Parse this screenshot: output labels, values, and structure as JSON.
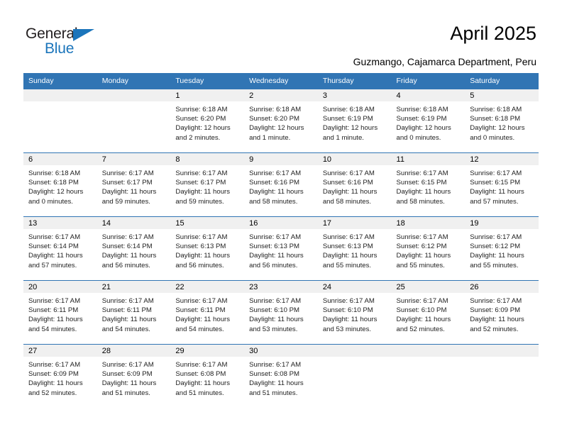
{
  "brand": {
    "name_part1": "General",
    "name_part2": "Blue",
    "triangle_icon": "triangle-icon",
    "color_dark": "#231f20",
    "color_blue": "#1b75bb"
  },
  "header": {
    "title": "April 2025",
    "subtitle": "Guzmango, Cajamarca Department, Peru"
  },
  "calendar": {
    "accent_color": "#3175b4",
    "daynum_band_color": "#f0f0f0",
    "weekday_headers": [
      "Sunday",
      "Monday",
      "Tuesday",
      "Wednesday",
      "Thursday",
      "Friday",
      "Saturday"
    ],
    "weeks": [
      [
        {
          "day": "",
          "empty": true
        },
        {
          "day": "",
          "empty": true
        },
        {
          "day": "1",
          "sunrise": "Sunrise: 6:18 AM",
          "sunset": "Sunset: 6:20 PM",
          "daylight": "Daylight: 12 hours and 2 minutes."
        },
        {
          "day": "2",
          "sunrise": "Sunrise: 6:18 AM",
          "sunset": "Sunset: 6:20 PM",
          "daylight": "Daylight: 12 hours and 1 minute."
        },
        {
          "day": "3",
          "sunrise": "Sunrise: 6:18 AM",
          "sunset": "Sunset: 6:19 PM",
          "daylight": "Daylight: 12 hours and 1 minute."
        },
        {
          "day": "4",
          "sunrise": "Sunrise: 6:18 AM",
          "sunset": "Sunset: 6:19 PM",
          "daylight": "Daylight: 12 hours and 0 minutes."
        },
        {
          "day": "5",
          "sunrise": "Sunrise: 6:18 AM",
          "sunset": "Sunset: 6:18 PM",
          "daylight": "Daylight: 12 hours and 0 minutes."
        }
      ],
      [
        {
          "day": "6",
          "sunrise": "Sunrise: 6:18 AM",
          "sunset": "Sunset: 6:18 PM",
          "daylight": "Daylight: 12 hours and 0 minutes."
        },
        {
          "day": "7",
          "sunrise": "Sunrise: 6:17 AM",
          "sunset": "Sunset: 6:17 PM",
          "daylight": "Daylight: 11 hours and 59 minutes."
        },
        {
          "day": "8",
          "sunrise": "Sunrise: 6:17 AM",
          "sunset": "Sunset: 6:17 PM",
          "daylight": "Daylight: 11 hours and 59 minutes."
        },
        {
          "day": "9",
          "sunrise": "Sunrise: 6:17 AM",
          "sunset": "Sunset: 6:16 PM",
          "daylight": "Daylight: 11 hours and 58 minutes."
        },
        {
          "day": "10",
          "sunrise": "Sunrise: 6:17 AM",
          "sunset": "Sunset: 6:16 PM",
          "daylight": "Daylight: 11 hours and 58 minutes."
        },
        {
          "day": "11",
          "sunrise": "Sunrise: 6:17 AM",
          "sunset": "Sunset: 6:15 PM",
          "daylight": "Daylight: 11 hours and 58 minutes."
        },
        {
          "day": "12",
          "sunrise": "Sunrise: 6:17 AM",
          "sunset": "Sunset: 6:15 PM",
          "daylight": "Daylight: 11 hours and 57 minutes."
        }
      ],
      [
        {
          "day": "13",
          "sunrise": "Sunrise: 6:17 AM",
          "sunset": "Sunset: 6:14 PM",
          "daylight": "Daylight: 11 hours and 57 minutes."
        },
        {
          "day": "14",
          "sunrise": "Sunrise: 6:17 AM",
          "sunset": "Sunset: 6:14 PM",
          "daylight": "Daylight: 11 hours and 56 minutes."
        },
        {
          "day": "15",
          "sunrise": "Sunrise: 6:17 AM",
          "sunset": "Sunset: 6:13 PM",
          "daylight": "Daylight: 11 hours and 56 minutes."
        },
        {
          "day": "16",
          "sunrise": "Sunrise: 6:17 AM",
          "sunset": "Sunset: 6:13 PM",
          "daylight": "Daylight: 11 hours and 56 minutes."
        },
        {
          "day": "17",
          "sunrise": "Sunrise: 6:17 AM",
          "sunset": "Sunset: 6:13 PM",
          "daylight": "Daylight: 11 hours and 55 minutes."
        },
        {
          "day": "18",
          "sunrise": "Sunrise: 6:17 AM",
          "sunset": "Sunset: 6:12 PM",
          "daylight": "Daylight: 11 hours and 55 minutes."
        },
        {
          "day": "19",
          "sunrise": "Sunrise: 6:17 AM",
          "sunset": "Sunset: 6:12 PM",
          "daylight": "Daylight: 11 hours and 55 minutes."
        }
      ],
      [
        {
          "day": "20",
          "sunrise": "Sunrise: 6:17 AM",
          "sunset": "Sunset: 6:11 PM",
          "daylight": "Daylight: 11 hours and 54 minutes."
        },
        {
          "day": "21",
          "sunrise": "Sunrise: 6:17 AM",
          "sunset": "Sunset: 6:11 PM",
          "daylight": "Daylight: 11 hours and 54 minutes."
        },
        {
          "day": "22",
          "sunrise": "Sunrise: 6:17 AM",
          "sunset": "Sunset: 6:11 PM",
          "daylight": "Daylight: 11 hours and 54 minutes."
        },
        {
          "day": "23",
          "sunrise": "Sunrise: 6:17 AM",
          "sunset": "Sunset: 6:10 PM",
          "daylight": "Daylight: 11 hours and 53 minutes."
        },
        {
          "day": "24",
          "sunrise": "Sunrise: 6:17 AM",
          "sunset": "Sunset: 6:10 PM",
          "daylight": "Daylight: 11 hours and 53 minutes."
        },
        {
          "day": "25",
          "sunrise": "Sunrise: 6:17 AM",
          "sunset": "Sunset: 6:10 PM",
          "daylight": "Daylight: 11 hours and 52 minutes."
        },
        {
          "day": "26",
          "sunrise": "Sunrise: 6:17 AM",
          "sunset": "Sunset: 6:09 PM",
          "daylight": "Daylight: 11 hours and 52 minutes."
        }
      ],
      [
        {
          "day": "27",
          "sunrise": "Sunrise: 6:17 AM",
          "sunset": "Sunset: 6:09 PM",
          "daylight": "Daylight: 11 hours and 52 minutes."
        },
        {
          "day": "28",
          "sunrise": "Sunrise: 6:17 AM",
          "sunset": "Sunset: 6:09 PM",
          "daylight": "Daylight: 11 hours and 51 minutes."
        },
        {
          "day": "29",
          "sunrise": "Sunrise: 6:17 AM",
          "sunset": "Sunset: 6:08 PM",
          "daylight": "Daylight: 11 hours and 51 minutes."
        },
        {
          "day": "30",
          "sunrise": "Sunrise: 6:17 AM",
          "sunset": "Sunset: 6:08 PM",
          "daylight": "Daylight: 11 hours and 51 minutes."
        },
        {
          "day": "",
          "empty": true
        },
        {
          "day": "",
          "empty": true
        },
        {
          "day": "",
          "empty": true
        }
      ]
    ]
  }
}
